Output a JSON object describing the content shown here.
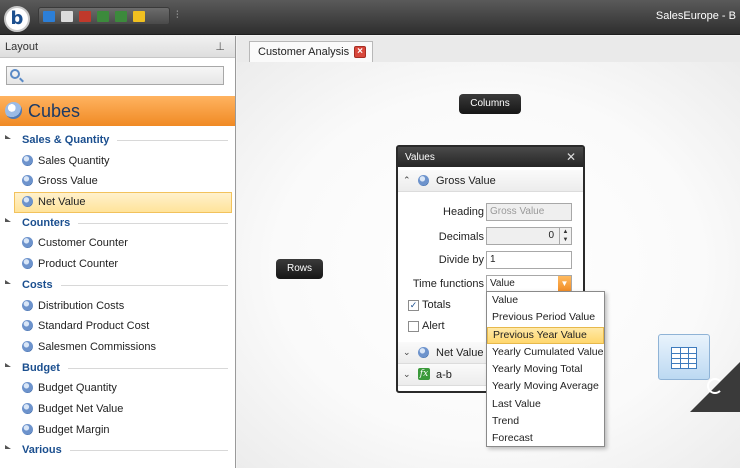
{
  "window": {
    "title": "SalesEurope - B"
  },
  "layout_panel": {
    "title": "Layout",
    "pin_glyph": "⊥",
    "search_placeholder": "",
    "cubes_label": "Cubes",
    "groups": [
      {
        "label": "Sales & Quantity",
        "items": [
          {
            "label": "Sales Quantity"
          },
          {
            "label": "Gross Value"
          },
          {
            "label": "Net Value",
            "selected": true
          }
        ]
      },
      {
        "label": "Counters",
        "items": [
          {
            "label": "Customer Counter"
          },
          {
            "label": "Product Counter"
          }
        ]
      },
      {
        "label": "Costs",
        "items": [
          {
            "label": "Distribution Costs"
          },
          {
            "label": "Standard Product Cost"
          },
          {
            "label": "Salesmen Commissions"
          }
        ]
      },
      {
        "label": "Budget",
        "items": [
          {
            "label": "Budget Quantity"
          },
          {
            "label": "Budget Net Value"
          },
          {
            "label": "Budget Margin"
          }
        ]
      },
      {
        "label": "Various",
        "items": []
      }
    ]
  },
  "document": {
    "tab_label": "Customer Analysis",
    "columns_label": "Columns",
    "rows_label": "Rows"
  },
  "values_dialog": {
    "title": "Values",
    "close_glyph": "✕",
    "sections": [
      {
        "label": "Gross Value",
        "expanded": true,
        "icon": "cube-icon"
      },
      {
        "label": "Net Value",
        "expanded": false,
        "icon": "cube-icon"
      },
      {
        "label": "a-b",
        "expanded": false,
        "icon": "formula-icon"
      }
    ],
    "heading_label": "Heading",
    "heading_value": "Gross Value",
    "decimals_label": "Decimals",
    "decimals_value": "0",
    "divide_label": "Divide by",
    "divide_value": "1",
    "time_functions_label": "Time functions",
    "time_functions_value": "Value",
    "totals_label": "Totals",
    "totals_checked": true,
    "alert_label": "Alert",
    "alert_checked": false
  },
  "time_functions_options": [
    {
      "label": "Value"
    },
    {
      "label": "Previous Period Value"
    },
    {
      "label": "Previous Year Value",
      "highlighted": true
    },
    {
      "label": "Yearly Cumulated Value"
    },
    {
      "label": "Yearly Moving Total"
    },
    {
      "label": "Yearly Moving Average"
    },
    {
      "label": "Last Value"
    },
    {
      "label": "Trend"
    },
    {
      "label": "Forecast"
    }
  ],
  "colors": {
    "accent_orange": "#f08a24",
    "tree_group_blue": "#1b4f8f",
    "selection_yellow": "#ffe39a"
  }
}
